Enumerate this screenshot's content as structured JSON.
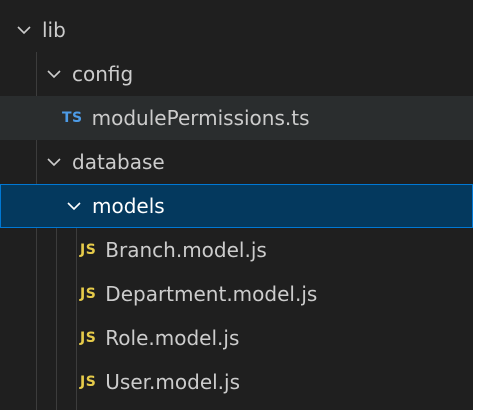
{
  "colors": {
    "background": "#1f1f1f",
    "selection": "#04395e",
    "focus_border": "#0078d4",
    "ts_badge": "#4d9be6",
    "js_badge": "#e6cb4a"
  },
  "tree": {
    "lib": {
      "label": "lib",
      "icon": "chevron-down-icon",
      "expanded": true
    },
    "config": {
      "label": "config",
      "icon": "chevron-down-icon",
      "expanded": true
    },
    "module_permissions": {
      "badge": "TS",
      "label": "modulePermissions.ts"
    },
    "database": {
      "label": "database",
      "icon": "chevron-down-icon",
      "expanded": true
    },
    "models": {
      "label": "models",
      "icon": "chevron-down-icon",
      "expanded": true,
      "selected": true
    },
    "files": [
      {
        "badge": "JS",
        "label": "Branch.model.js"
      },
      {
        "badge": "JS",
        "label": "Department.model.js"
      },
      {
        "badge": "JS",
        "label": "Role.model.js"
      },
      {
        "badge": "JS",
        "label": "User.model.js"
      }
    ]
  }
}
